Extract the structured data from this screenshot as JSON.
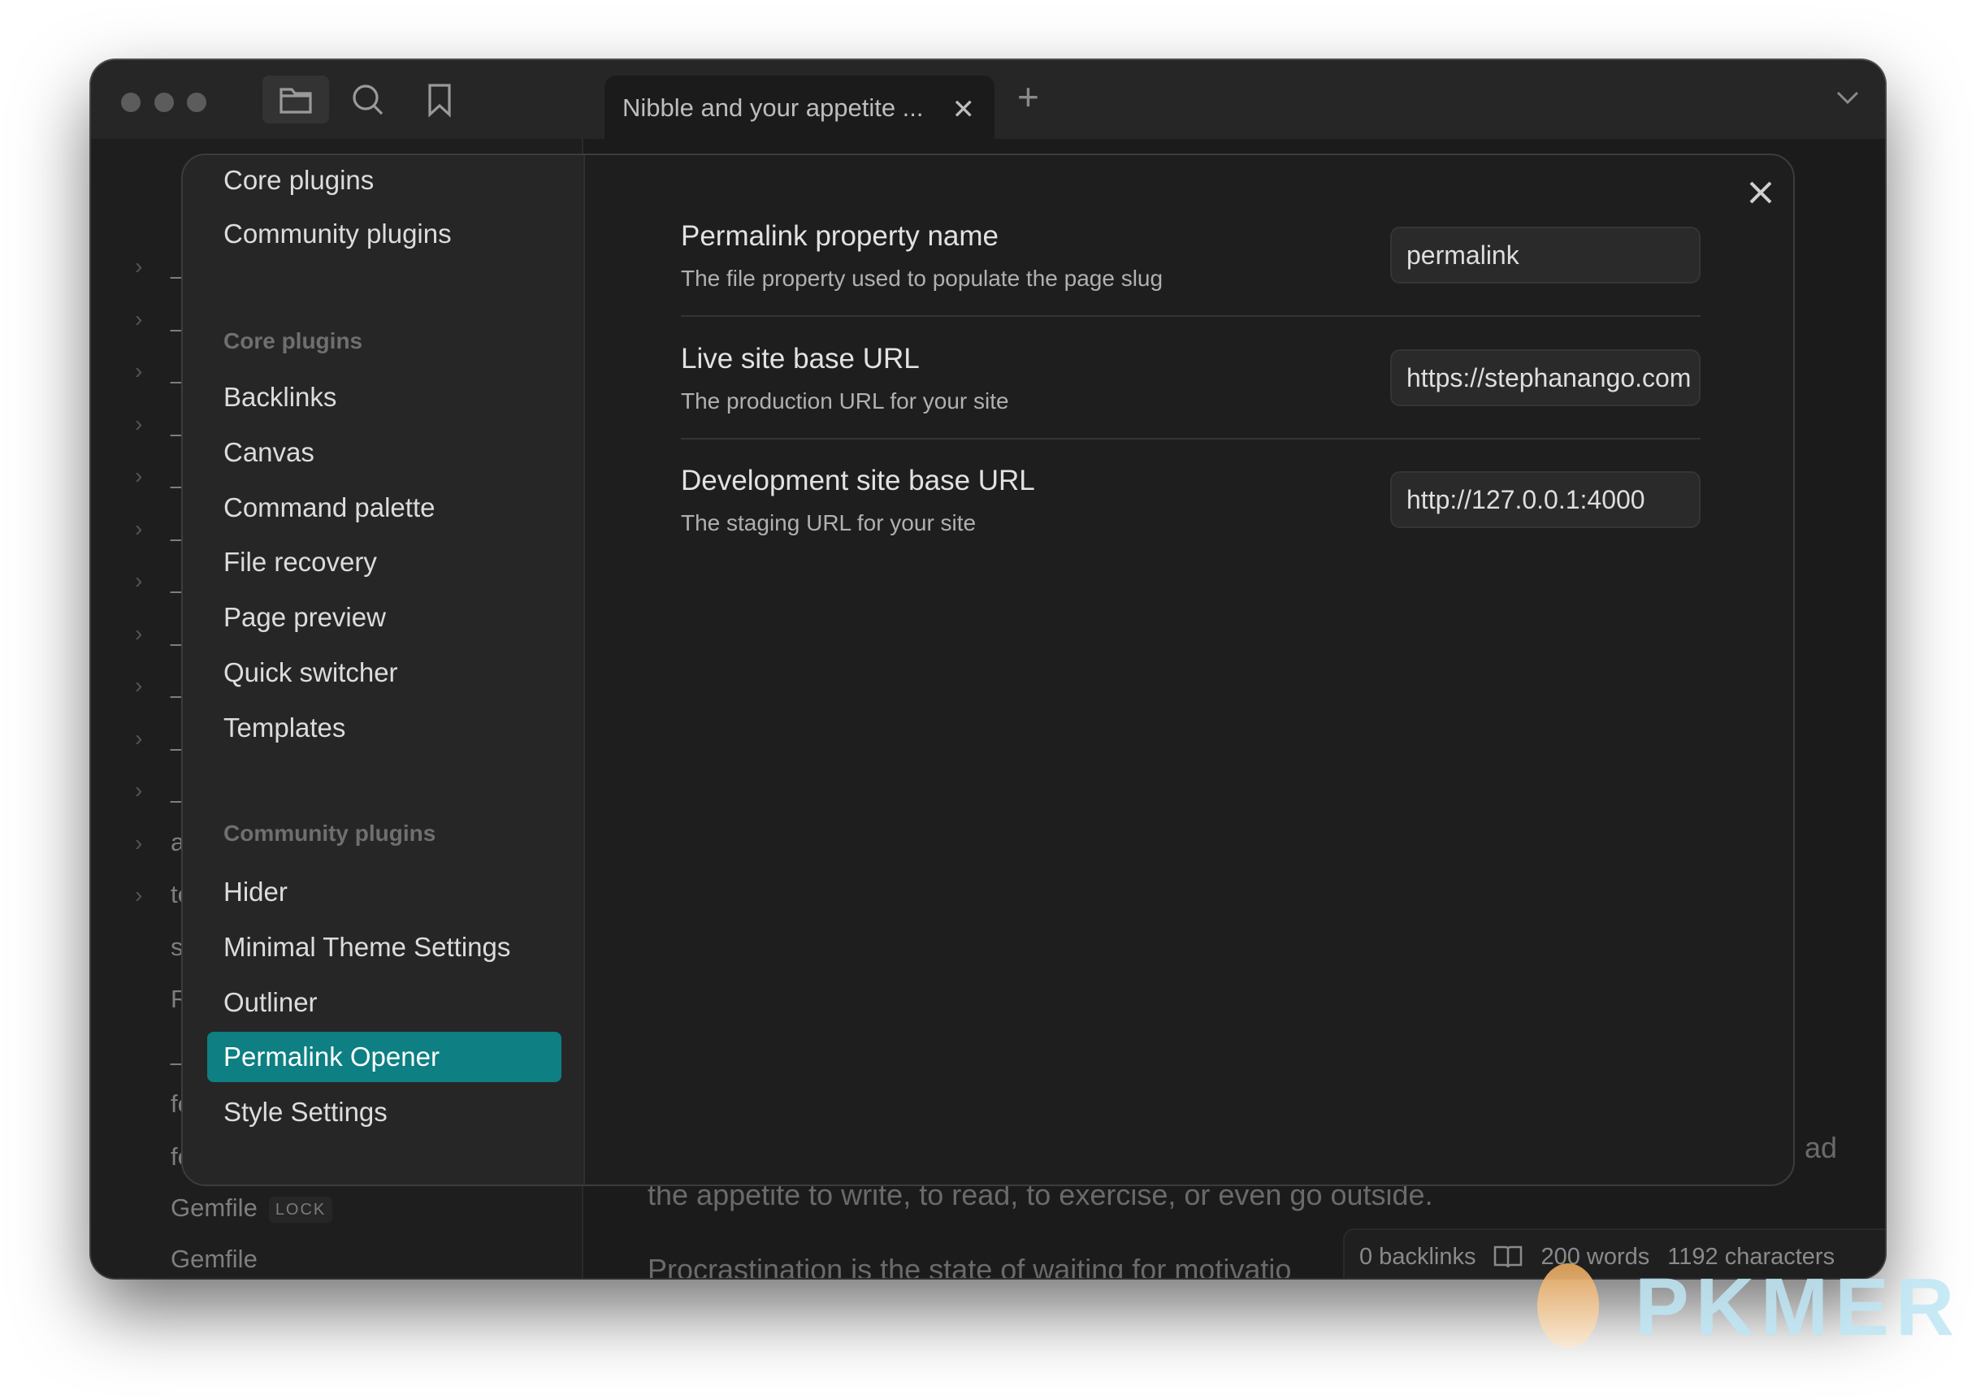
{
  "titlebar": {
    "tab_title": "Nibble and your appetite ...",
    "tab_close": "✕",
    "new_tab": "+"
  },
  "filetree": {
    "items": [
      {
        "label": "_c",
        "folder": true
      },
      {
        "label": "_i",
        "folder": true
      },
      {
        "label": "_l",
        "folder": true
      },
      {
        "label": "_n",
        "folder": true
      },
      {
        "label": "_l",
        "folder": true
      },
      {
        "label": "_l",
        "folder": true
      },
      {
        "label": "_l",
        "folder": true
      },
      {
        "label": "_l",
        "folder": true
      },
      {
        "label": "_n",
        "folder": true
      },
      {
        "label": "_s",
        "folder": true
      },
      {
        "label": "_s",
        "folder": true
      },
      {
        "label": "as",
        "folder": true
      },
      {
        "label": "te",
        "folder": true
      },
      {
        "label": "st",
        "folder": false
      },
      {
        "label": "RI",
        "folder": false
      },
      {
        "label": "_c",
        "folder": false
      },
      {
        "label": "fe",
        "folder": false
      },
      {
        "label": "fe",
        "folder": false
      }
    ],
    "gemfile_lock": "Gemfile",
    "lock_badge": "LOCK",
    "gemfile": "Gemfile"
  },
  "editor": {
    "line_fragment": "ad",
    "line1": "the appetite to write, to read, to exercise, or even go outside.",
    "line2": "Procrastination is the state of waiting for motivatio"
  },
  "statusbar": {
    "backlinks": "0 backlinks",
    "words": "200 words",
    "characters": "1192 characters"
  },
  "settings": {
    "nav_top": [
      "Core plugins",
      "Community plugins"
    ],
    "core_header": "Core plugins",
    "core_items": [
      "Backlinks",
      "Canvas",
      "Command palette",
      "File recovery",
      "Page preview",
      "Quick switcher",
      "Templates"
    ],
    "community_header": "Community plugins",
    "community_items": [
      "Hider",
      "Minimal Theme Settings",
      "Outliner",
      "Permalink Opener",
      "Style Settings"
    ],
    "active_item": "Permalink Opener",
    "rows": [
      {
        "title": "Permalink property name",
        "desc": "The file property used to populate the page slug",
        "value": "permalink"
      },
      {
        "title": "Live site base URL",
        "desc": "The production URL for your site",
        "value": "https://stephanango.com"
      },
      {
        "title": "Development site base URL",
        "desc": "The staging URL for your site",
        "value": "http://127.0.0.1:4000"
      }
    ]
  },
  "watermark": {
    "text": "PKMER"
  },
  "colors": {
    "accent": "#0e7f83",
    "background": "#1e1e1e"
  }
}
